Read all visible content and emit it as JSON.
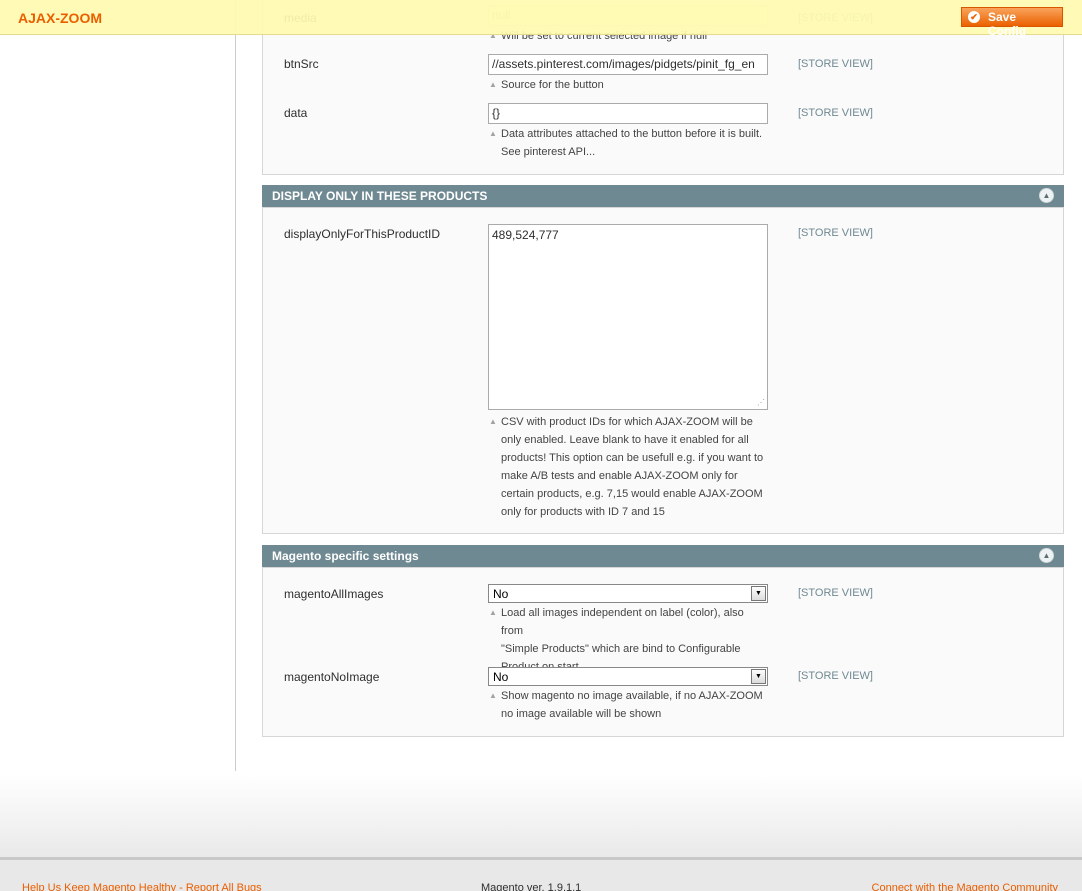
{
  "header": {
    "title": "AJAX-ZOOM",
    "save_label": "Save Config"
  },
  "scope_label": "[STORE VIEW]",
  "pinterest_group": {
    "rows": [
      {
        "label": "media",
        "value": "null",
        "note": "Will be set to current selected image if null"
      },
      {
        "label": "btnSrc",
        "value": "//assets.pinterest.com/images/pidgets/pinit_fg_en",
        "note": "Source for the button"
      },
      {
        "label": "data",
        "value": "{}",
        "note_lines": [
          "Data attributes attached to the button before it is built.",
          "See pinterest API..."
        ]
      }
    ]
  },
  "display_section": {
    "title": "DISPLAY ONLY IN THESE PRODUCTS",
    "label": "displayOnlyForThisProductID",
    "value": "489,524,777",
    "note_lines": [
      "CSV with product IDs for which AJAX-ZOOM will be",
      "only enabled. Leave blank to have it enabled for all",
      "products! This option can be usefull e.g. if you want to",
      "make A/B tests and enable AJAX-ZOOM only for",
      "certain products, e.g. 7,15 would enable AJAX-ZOOM",
      "only for products with ID 7 and 15"
    ]
  },
  "magento_section": {
    "title": "Magento specific settings",
    "rows": [
      {
        "label": "magentoAllImages",
        "value": "No",
        "note_lines": [
          "Load all images independent on label (color), also from",
          "\"Simple Products\" which are bind to Configurable",
          "Product on start."
        ]
      },
      {
        "label": "magentoNoImage",
        "value": "No",
        "note_lines": [
          "Show magento no image available, if no AJAX-ZOOM",
          "no image available will be shown"
        ]
      }
    ]
  },
  "footer": {
    "left": "Help Us Keep Magento Healthy - Report All Bugs",
    "middle": "Magento ver. 1.9.1.1",
    "right": "Connect with the Magento Community"
  },
  "colors": {
    "accent": "#eb5e00",
    "section_header": "#6f8992",
    "header_bar": "#fffbb0"
  },
  "icons": [
    "arrow-up-icon",
    "collapse-icon",
    "check-icon",
    "chevron-down-icon",
    "resize-grip-icon"
  ]
}
